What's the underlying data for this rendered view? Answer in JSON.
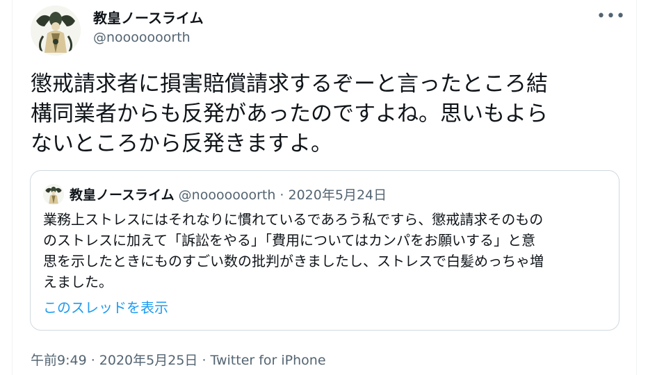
{
  "author": {
    "name": "教皇ノースライム",
    "handle": "@nooooooorth",
    "avatar_icon": "pope-illustration-avatar"
  },
  "more_button": {
    "label": "•••",
    "icon": "more-horizontal-icon"
  },
  "tweet": {
    "text": "懲戒請求者に損害賠償請求するぞーと言ったところ結\n構同業者からも反発があったのですよね。思いもよら\nないところから反発きますよ。"
  },
  "quote": {
    "author_name": "教皇ノースライム",
    "meta": "@nooooooorth · 2020年5月24日",
    "text": "業務上ストレスにはそれなりに慣れているであろう私ですら、懲戒請求そのもの\nのストレスに加えて「訴訟をやる」「費用についてはカンパをお願いする」と意\n思を示したときにものすごい数の批判がきましたし、ストレスで白髪めっちゃ増\nえました。",
    "show_thread": "このスレッドを表示"
  },
  "footer": {
    "timestamp": "午前9:49 · 2020年5月25日 · Twitter for iPhone"
  },
  "colors": {
    "text": "#0f1419",
    "secondary": "#536471",
    "link": "#1d9bf0",
    "border": "#cfd9de"
  }
}
